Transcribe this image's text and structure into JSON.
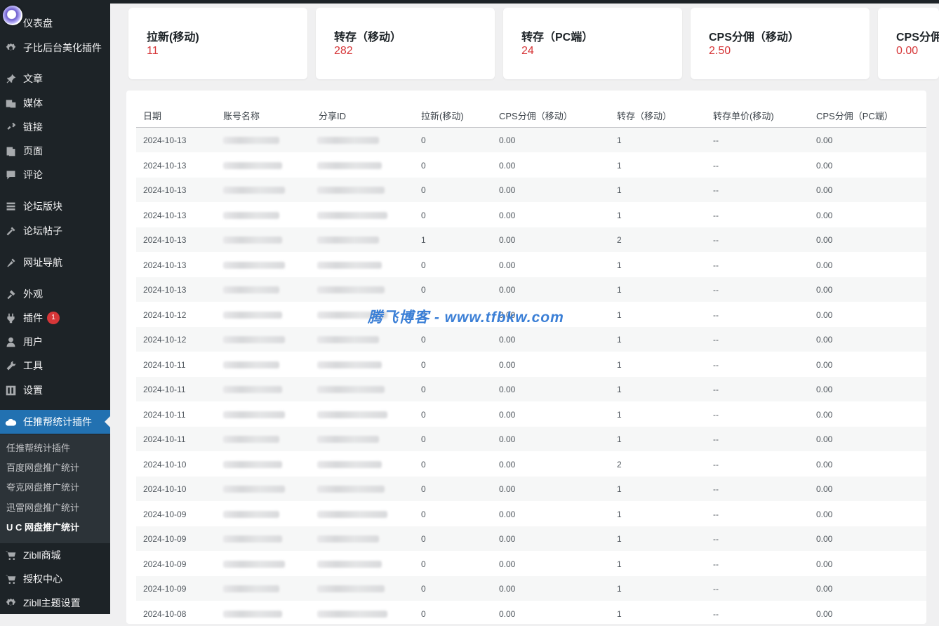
{
  "sidebar": {
    "items": [
      {
        "label": "仪表盘",
        "icon": "dashboard-icon"
      },
      {
        "label": "子比后台美化插件",
        "icon": "gear-icon"
      },
      {
        "label": "文章",
        "icon": "pin-icon"
      },
      {
        "label": "媒体",
        "icon": "media-icon"
      },
      {
        "label": "链接",
        "icon": "link-icon"
      },
      {
        "label": "页面",
        "icon": "page-icon"
      },
      {
        "label": "评论",
        "icon": "comment-icon"
      },
      {
        "label": "论坛版块",
        "icon": "forum-icon"
      },
      {
        "label": "论坛帖子",
        "icon": "tools-icon"
      },
      {
        "label": "网址导航",
        "icon": "brush-icon"
      },
      {
        "label": "外观",
        "icon": "appearance-icon"
      },
      {
        "label": "插件",
        "icon": "plugin-icon",
        "badge": "1"
      },
      {
        "label": "用户",
        "icon": "user-icon"
      },
      {
        "label": "工具",
        "icon": "wrench-icon"
      },
      {
        "label": "设置",
        "icon": "settings-icon"
      },
      {
        "label": "任推帮统计插件",
        "icon": "cloud-icon",
        "active": true
      },
      {
        "label": "Zibll商城",
        "icon": "cart-icon"
      },
      {
        "label": "授权中心",
        "icon": "cart-icon"
      },
      {
        "label": "Zibll主题设置",
        "icon": "gear-icon"
      }
    ],
    "submenu": [
      {
        "label": "任推帮统计插件"
      },
      {
        "label": "百度网盘推广统计"
      },
      {
        "label": "夸克网盘推广统计"
      },
      {
        "label": "迅雷网盘推广统计"
      },
      {
        "label": "U C 网盘推广统计",
        "current": true
      }
    ]
  },
  "cards": [
    {
      "title": "拉新(移动)",
      "value": "11"
    },
    {
      "title": "转存（移动）",
      "value": "282"
    },
    {
      "title": "转存（PC端）",
      "value": "24"
    },
    {
      "title": "CPS分佣（移动）",
      "value": "2.50"
    },
    {
      "title": "CPS分佣",
      "value": "0.00"
    }
  ],
  "table": {
    "headers": [
      "日期",
      "账号名称",
      "分享ID",
      "拉新(移动)",
      "CPS分佣（移动）",
      "转存（移动）",
      "转存单价(移动)",
      "CPS分佣（PC端）"
    ],
    "rows": [
      [
        "2024-10-13",
        "0",
        "0.00",
        "1",
        "--",
        "0.00"
      ],
      [
        "2024-10-13",
        "0",
        "0.00",
        "1",
        "--",
        "0.00"
      ],
      [
        "2024-10-13",
        "0",
        "0.00",
        "1",
        "--",
        "0.00"
      ],
      [
        "2024-10-13",
        "0",
        "0.00",
        "1",
        "--",
        "0.00"
      ],
      [
        "2024-10-13",
        "1",
        "0.00",
        "2",
        "--",
        "0.00"
      ],
      [
        "2024-10-13",
        "0",
        "0.00",
        "1",
        "--",
        "0.00"
      ],
      [
        "2024-10-13",
        "0",
        "0.00",
        "1",
        "--",
        "0.00"
      ],
      [
        "2024-10-12",
        "0",
        "0.00",
        "1",
        "--",
        "0.00"
      ],
      [
        "2024-10-12",
        "0",
        "0.00",
        "1",
        "--",
        "0.00"
      ],
      [
        "2024-10-11",
        "0",
        "0.00",
        "1",
        "--",
        "0.00"
      ],
      [
        "2024-10-11",
        "0",
        "0.00",
        "1",
        "--",
        "0.00"
      ],
      [
        "2024-10-11",
        "0",
        "0.00",
        "1",
        "--",
        "0.00"
      ],
      [
        "2024-10-11",
        "0",
        "0.00",
        "1",
        "--",
        "0.00"
      ],
      [
        "2024-10-10",
        "0",
        "0.00",
        "2",
        "--",
        "0.00"
      ],
      [
        "2024-10-10",
        "0",
        "0.00",
        "1",
        "--",
        "0.00"
      ],
      [
        "2024-10-09",
        "0",
        "0.00",
        "1",
        "--",
        "0.00"
      ],
      [
        "2024-10-09",
        "0",
        "0.00",
        "1",
        "--",
        "0.00"
      ],
      [
        "2024-10-09",
        "0",
        "0.00",
        "1",
        "--",
        "0.00"
      ],
      [
        "2024-10-09",
        "0",
        "0.00",
        "1",
        "--",
        "0.00"
      ],
      [
        "2024-10-08",
        "0",
        "0.00",
        "1",
        "--",
        "0.00"
      ]
    ]
  },
  "watermark": "腾飞博客 - www.tfbkw.com",
  "colors": {
    "sidebar": "#1d2327",
    "active": "#2271b1",
    "value_red": "#d63638"
  }
}
